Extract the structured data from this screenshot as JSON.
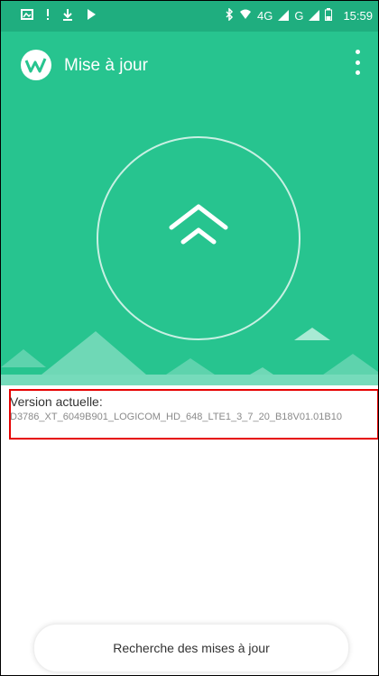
{
  "status_bar": {
    "time": "15:59",
    "network_label": "4G",
    "icons_left": [
      "photo-notification-icon",
      "alert-icon",
      "download-icon",
      "play-icon"
    ],
    "icons_right": [
      "bluetooth-icon",
      "wifi-icon",
      "signal-icon",
      "signal-icon",
      "battery-icon"
    ]
  },
  "header": {
    "title": "Mise à jour",
    "menu_icon": "more-vertical-icon",
    "logo_icon": "update-logo-icon"
  },
  "hero": {
    "update_icon": "double-chevron-up-icon"
  },
  "version": {
    "label": "Version actuelle:",
    "value": "D3786_XT_6049B901_LOGICOM_HD_648_LTE1_3_7_20_B18V01.01B10"
  },
  "actions": {
    "check_button_label": "Recherche des mises à jour"
  },
  "colors": {
    "primary": "#27c48f",
    "status_bar": "#1fae7f",
    "highlight": "#e60000"
  }
}
